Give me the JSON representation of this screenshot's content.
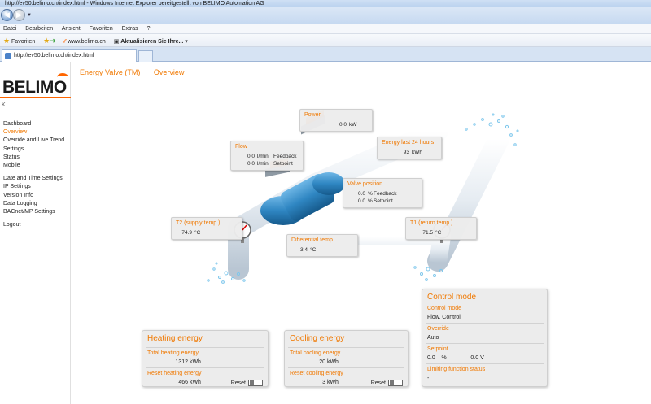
{
  "browser": {
    "title": "http://ev50.belimo.ch/index.html - Windows Internet Explorer bereitgestellt von BELIMO Automation AG",
    "menu": [
      "Datei",
      "Bearbeiten",
      "Ansicht",
      "Favoriten",
      "Extras",
      "?"
    ],
    "favorites_label": "Favoriten",
    "fav_site": "www.belimo.ch",
    "fav_update": "Aktualisieren Sie Ihre...",
    "tab_title": "http://ev50.belimo.ch/index.html"
  },
  "logo": {
    "text": "BELIMO",
    "sub": "K"
  },
  "sidebar": {
    "items_a": [
      "Dashboard",
      "Overview",
      "Override and Live Trend",
      "Settings",
      "Status",
      "Mobile"
    ],
    "items_b": [
      "Date and Time Settings",
      "IP Settings",
      "Version Info",
      "Data Logging",
      "BACnet/MP Settings"
    ],
    "logout": "Logout"
  },
  "breadcrumb": {
    "product": "Energy Valve (TM)",
    "page": "Overview"
  },
  "overview": {
    "power": {
      "title": "Power",
      "value": "0.0",
      "unit": "kW"
    },
    "energy24": {
      "title": "Energy last 24 hours",
      "value": "93",
      "unit": "kWh"
    },
    "flow": {
      "title": "Flow",
      "feedback": "0.0",
      "setpoint": "0.0",
      "unit": "l/min",
      "feedback_label": "Feedback",
      "setpoint_label": "Setpoint"
    },
    "valve": {
      "title": "Valve position",
      "feedback": "0.0",
      "setpoint": "0.0",
      "unit": "%",
      "feedback_label": "Feedback",
      "setpoint_label": "Setpoint"
    },
    "t2": {
      "title": "T2 (supply temp.)",
      "value": "74.9",
      "unit": "°C"
    },
    "t1": {
      "title": "T1 (return temp.)",
      "value": "71.5",
      "unit": "°C"
    },
    "dt": {
      "title": "Differential temp.",
      "value": "3.4",
      "unit": "°C"
    }
  },
  "heating": {
    "title": "Heating energy",
    "total_label": "Total heating energy",
    "total": "1312",
    "total_unit": "kWh",
    "reset_label": "Reset heating energy",
    "reset_value": "466",
    "reset_unit": "kWh",
    "reset_button": "Reset"
  },
  "cooling": {
    "title": "Cooling energy",
    "total_label": "Total cooling energy",
    "total": "20",
    "total_unit": "kWh",
    "reset_label": "Reset cooling energy",
    "reset_value": "3",
    "reset_unit": "kWh",
    "reset_button": "Reset"
  },
  "control": {
    "title": "Control mode",
    "mode_label": "Control mode",
    "mode": "Flow. Control",
    "override_label": "Override",
    "override": "Auto",
    "setpoint_label": "Setpoint",
    "sp_pct": "0.0",
    "sp_pct_unit": "%",
    "sp_volt": "0.0 V",
    "limit_label": "Limiting function status",
    "limit": "-"
  },
  "colors": {
    "accent": "#f07800",
    "pipe": "#e8eef4",
    "valve_body": "#2f86c2"
  }
}
